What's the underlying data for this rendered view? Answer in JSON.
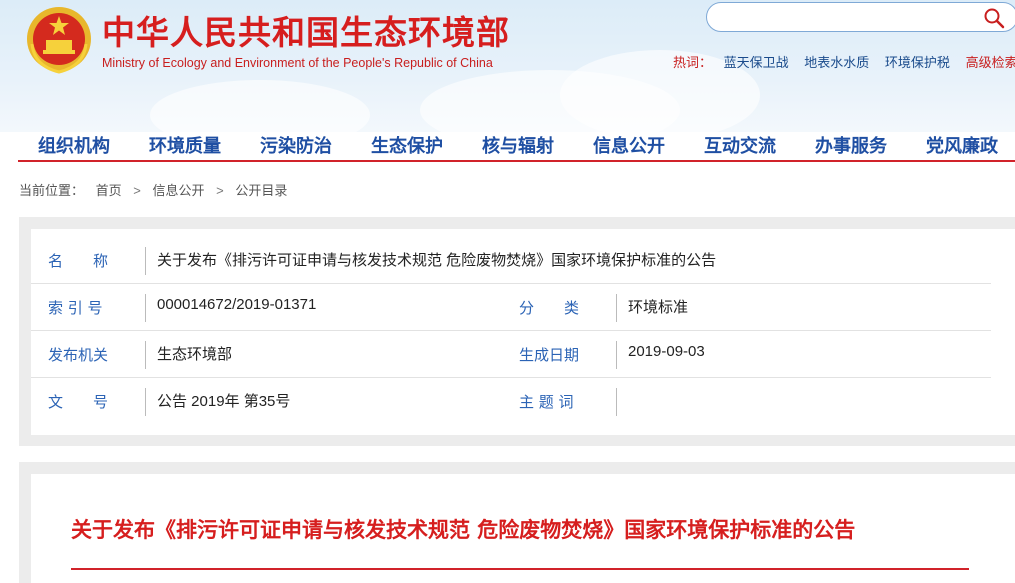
{
  "header": {
    "title": "中华人民共和国生态环境部",
    "subtitle": "Ministry of Ecology and Environment of the People's Republic of China",
    "search": {
      "placeholder": "",
      "icon": "search-icon"
    },
    "hotwords_label": "热词：",
    "hotwords": [
      "蓝天保卫战",
      "地表水水质",
      "环境保护税"
    ],
    "advanced_search": "高级检索"
  },
  "nav": [
    "组织机构",
    "环境质量",
    "污染防治",
    "生态保护",
    "核与辐射",
    "信息公开",
    "互动交流",
    "办事服务",
    "党风廉政"
  ],
  "breadcrumb": {
    "label": "当前位置：",
    "items": [
      "首页",
      "信息公开",
      "公开目录"
    ],
    "separator": ">"
  },
  "info": {
    "name_label": "名　　称",
    "name_value": "关于发布《排污许可证申请与核发技术规范 危险废物焚烧》国家环境保护标准的公告",
    "index_label": "索 引 号",
    "index_value": "000014672/2019-01371",
    "category_label": "分　　类",
    "category_value": "环境标准",
    "issuer_label": "发布机关",
    "issuer_value": "生态环境部",
    "date_label": "生成日期",
    "date_value": "2019-09-03",
    "docno_label": "文　　号",
    "docno_value": "公告 2019年 第35号",
    "keywords_label": "主 题 词",
    "keywords_value": ""
  },
  "document": {
    "title": "关于发布《排污许可证申请与核发技术规范 危险废物焚烧》国家环境保护标准的公告"
  },
  "colors": {
    "brand_red": "#d61e1e",
    "nav_blue": "#1f4fa3",
    "label_blue": "#2b63b5"
  }
}
